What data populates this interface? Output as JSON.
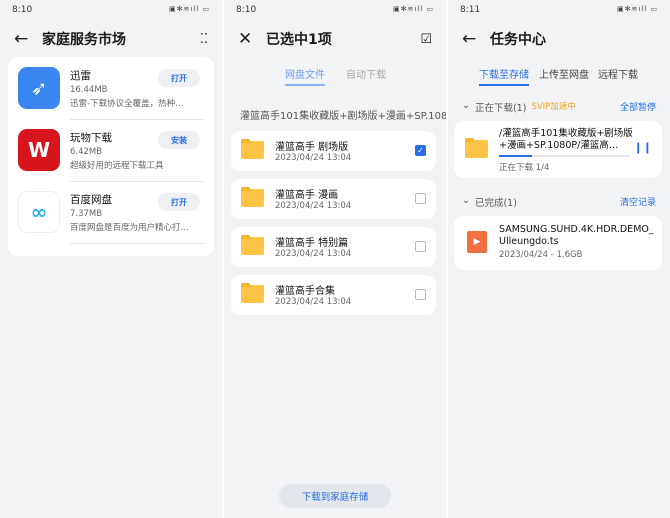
{
  "panel1": {
    "time": "8:10",
    "title": "家庭服务市场",
    "apps": [
      {
        "name": "迅雷",
        "size": "16.44MB",
        "desc": "迅雷-下载协议全覆盖，热种下…",
        "button": "打开",
        "color": "#3a86f0",
        "icon": "bird-icon"
      },
      {
        "name": "玩物下载",
        "size": "6.42MB",
        "desc": "超级好用的远程下载工具",
        "button": "安装",
        "color": "#d8141c",
        "icon": "w-logo-icon"
      },
      {
        "name": "百度网盘",
        "size": "7.37MB",
        "desc": "百度网盘是百度为用户精心打造…",
        "button": "打开",
        "color": "#ffffff",
        "icon": "cloud-icon"
      }
    ]
  },
  "panel2": {
    "time": "8:10",
    "title": "已选中1项",
    "tabs": [
      "网盘文件",
      "自动下载"
    ],
    "path": "灌篮高手101集收藏版+剧场版+漫画+SP.1080",
    "files": [
      {
        "name": "灌篮高手 剧场版",
        "date": "2023/04/24 13:04",
        "checked": true
      },
      {
        "name": "灌篮高手 漫画",
        "date": "2023/04/24 13:04",
        "checked": false
      },
      {
        "name": "灌篮高手 特别篇",
        "date": "2023/04/24 13:04",
        "checked": false
      },
      {
        "name": "灌篮高手合集",
        "date": "2023/04/24 13:04",
        "checked": false
      }
    ],
    "action": "下载到家庭存储"
  },
  "panel3": {
    "time": "8:11",
    "title": "任务中心",
    "tabs": [
      "下载至存储",
      "上传至网盘",
      "远程下载"
    ],
    "downloading": {
      "label": "正在下载(1)",
      "badge": "SVIP加速中",
      "action": "全部暂停",
      "name": "/灌篮高手101集收藏版+剧场版+漫画+SP.1080P/灌篮高…",
      "status": "正在下载 1/4",
      "progress": 0.25
    },
    "completed": {
      "label": "已完成(1)",
      "action": "清空记录",
      "name": "SAMSUNG.SUHD.4K.HDR.DEMO_Ulleungdo.ts",
      "meta": "2023/04/24 - 1.6GB"
    }
  },
  "accent": "#2a6ee8",
  "orange": "#f5a623"
}
